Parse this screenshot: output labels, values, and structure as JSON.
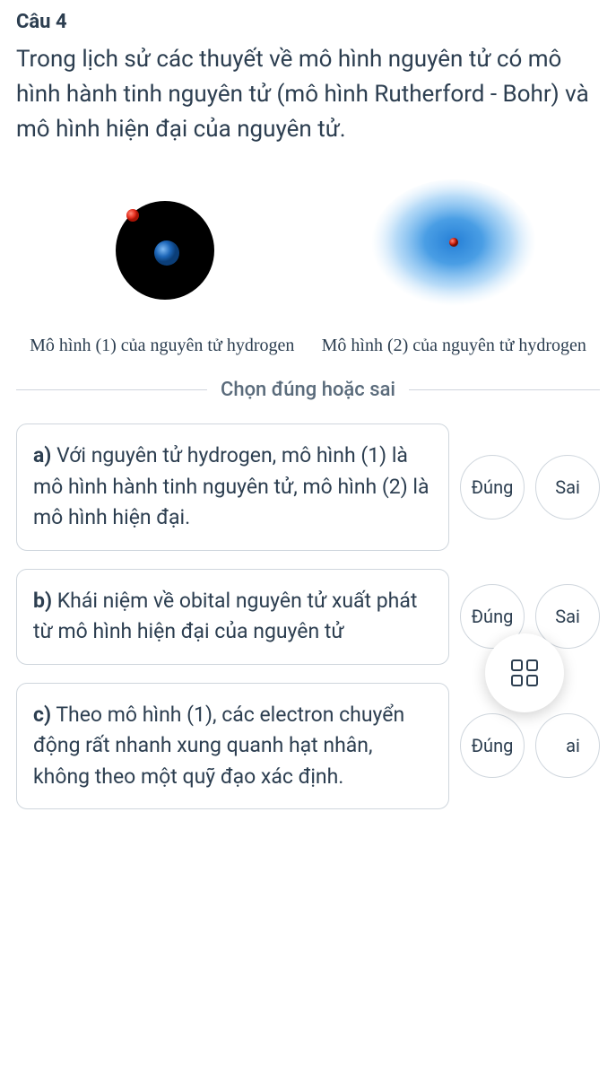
{
  "question": {
    "title": "Câu 4",
    "text": "Trong lịch sử các thuyết về mô hình nguyên tử có mô hình hành tinh nguyên tử (mô hình Rutherford - Bohr) và mô hình hiện đại của nguyên tử."
  },
  "models": {
    "caption1": "Mô hình (1) của nguyên tử hydrogen",
    "caption2": "Mô hình (2) của nguyên tử hydrogen"
  },
  "instruction": "Chọn đúng hoặc sai",
  "options": [
    {
      "label": "a)",
      "text": " Với nguyên tử hydrogen, mô hình (1) là mô hình hành tinh nguyên tử, mô hình (2) là mô hình hiện đại."
    },
    {
      "label": "b)",
      "text": " Khái niệm về obital nguyên tử xuất phát từ mô hình hiện đại của nguyên tử"
    },
    {
      "label": "c)",
      "text": " Theo mô hình (1), các electron chuyển động rất nhanh xung quanh hạt nhân, không theo một quỹ đạo xác định."
    }
  ],
  "buttons": {
    "true": "Đúng",
    "false": "Sai",
    "falsePartial": "ai"
  }
}
